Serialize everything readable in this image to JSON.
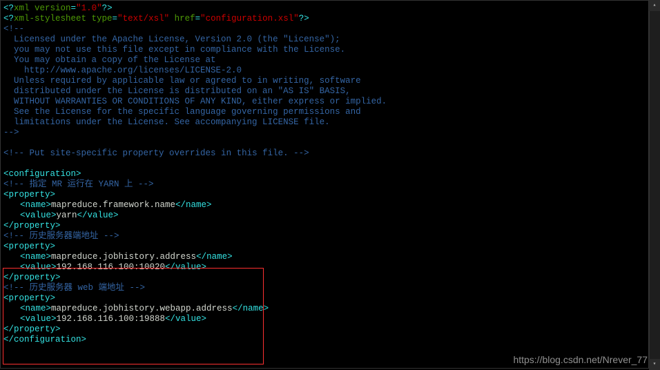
{
  "xml": {
    "decl_version": "1.0",
    "stylesheet_type": "text/xsl",
    "stylesheet_href": "configuration.xsl"
  },
  "license_lines": [
    "  Licensed under the Apache License, Version 2.0 (the \"License\");",
    "  you may not use this file except in compliance with the License.",
    "  You may obtain a copy of the License at",
    "",
    "    http://www.apache.org/licenses/LICENSE-2.0",
    "",
    "  Unless required by applicable law or agreed to in writing, software",
    "  distributed under the License is distributed on an \"AS IS\" BASIS,",
    "  WITHOUT WARRANTIES OR CONDITIONS OF ANY KIND, either express or implied.",
    "  See the License for the specific language governing permissions and",
    "  limitations under the License. See accompanying LICENSE file."
  ],
  "override_comment": " Put site-specific property overrides in this file. ",
  "root_tag": "configuration",
  "comments": {
    "yarn": " 指定 MR 运行在 YARN 上 ",
    "hist": " 历史服务器端地址 ",
    "web": " 历史服务器 web 端地址 "
  },
  "props": [
    {
      "name": "mapreduce.framework.name",
      "value": "yarn"
    },
    {
      "name": "mapreduce.jobhistory.address",
      "value": "192.168.116.100:10020"
    },
    {
      "name": "mapreduce.jobhistory.webapp.address",
      "value": "192.168.116.100:19888"
    }
  ],
  "tags": {
    "open_cmt": "<!--",
    "close_cmt": "-->",
    "prop_open": "<property>",
    "prop_close": "</property>",
    "name_open": "<name>",
    "name_close": "</name>",
    "value_open": "<value>",
    "value_close": "</value>",
    "conf_open": "<configuration>",
    "conf_close": "</configuration>"
  },
  "watermark": "https://blog.csdn.net/Nrever_77"
}
